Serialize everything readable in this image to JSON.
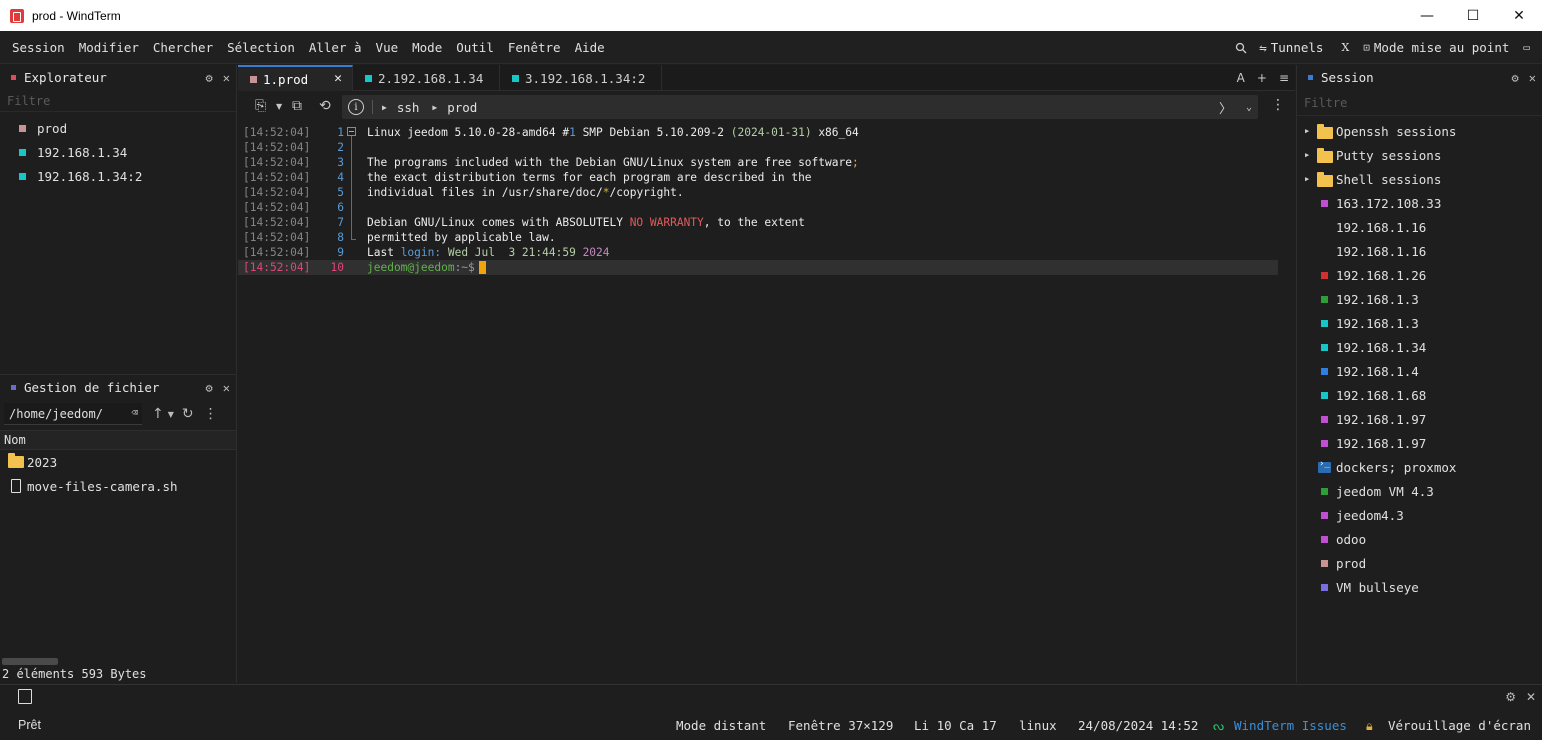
{
  "window": {
    "title": "prod - WindTerm",
    "controls": {
      "minimize": "—",
      "maximize": "☐",
      "close": "✕"
    }
  },
  "menu": {
    "items": [
      "Session",
      "Modifier",
      "Chercher",
      "Sélection",
      "Aller à",
      "Vue",
      "Mode",
      "Outil",
      "Fenêtre",
      "Aide"
    ],
    "right": {
      "tunnels": "Tunnels",
      "x_label": "X",
      "mode": "Mode mise au point"
    }
  },
  "explorer": {
    "title": "Explorateur",
    "filter_placeholder": "Filtre",
    "items": [
      {
        "label": "prod",
        "color": "#c89393"
      },
      {
        "label": "192.168.1.34",
        "color": "#17c7c7"
      },
      {
        "label": "192.168.1.34:2",
        "color": "#17c7c7"
      }
    ]
  },
  "file_manager": {
    "title": "Gestion de fichier",
    "path": "/home/jeedom/",
    "column_name": "Nom",
    "files": [
      {
        "name": "2023",
        "type": "folder"
      },
      {
        "name": "move-files-camera.sh",
        "type": "file"
      }
    ],
    "status": "2 éléments 593 Bytes"
  },
  "tabs": [
    {
      "label": "1.prod",
      "color": "#c89393",
      "active": true
    },
    {
      "label": "2.192.168.1.34",
      "color": "#17c7c7",
      "active": false
    },
    {
      "label": "3.192.168.1.34:2",
      "color": "#17c7c7",
      "active": false
    }
  ],
  "tab_actions": {
    "font": "A",
    "add": "+",
    "menu": "≡"
  },
  "address": {
    "segments": [
      "ssh",
      "prod"
    ]
  },
  "terminal": {
    "lines": [
      {
        "ts": "[14:52:04]",
        "n": "1",
        "segs": [
          [
            "Linux jeedom 5.10.0-28-amd64 #",
            "#ececec"
          ],
          [
            "1",
            "#5b9bd5"
          ],
          [
            " SMP Debian 5.10.209-2 ",
            "#ececec"
          ],
          [
            "(2024-01-31)",
            "#b5cea8"
          ],
          [
            " x86_64",
            "#ececec"
          ]
        ]
      },
      {
        "ts": "[14:52:04]",
        "n": "2",
        "segs": []
      },
      {
        "ts": "[14:52:04]",
        "n": "3",
        "segs": [
          [
            "The programs included with the Debian GNU/Linux system are free software",
            "#ececec"
          ],
          [
            ";",
            "#d4b44a"
          ]
        ]
      },
      {
        "ts": "[14:52:04]",
        "n": "4",
        "segs": [
          [
            "the exact distribution terms for each program are described in the",
            "#ececec"
          ]
        ]
      },
      {
        "ts": "[14:52:04]",
        "n": "5",
        "segs": [
          [
            "individual files in /usr/share/doc/",
            "#ececec"
          ],
          [
            "*",
            "#d4b44a"
          ],
          [
            "/copyright.",
            "#ececec"
          ]
        ]
      },
      {
        "ts": "[14:52:04]",
        "n": "6",
        "segs": []
      },
      {
        "ts": "[14:52:04]",
        "n": "7",
        "segs": [
          [
            "Debian GNU/Linux comes with ABSOLUTELY ",
            "#ececec"
          ],
          [
            "NO WARRANTY",
            "#e05a5a"
          ],
          [
            ", to the extent",
            "#ececec"
          ]
        ]
      },
      {
        "ts": "[14:52:04]",
        "n": "8",
        "segs": [
          [
            "permitted by applicable law.",
            "#ececec"
          ]
        ]
      },
      {
        "ts": "[14:52:04]",
        "n": "9",
        "segs": [
          [
            "Last ",
            "#ececec"
          ],
          [
            "login:",
            "#5b9bd5"
          ],
          [
            " Wed Jul  3 21:44:59 ",
            "#b5cea8"
          ],
          [
            "2024",
            "#c586c0"
          ]
        ]
      },
      {
        "ts": "[14:52:04]",
        "n": "10",
        "segs": [
          [
            "jeedom@jeedom",
            "#5fb34b"
          ],
          [
            ":~$",
            "#9a9a9a"
          ]
        ],
        "current": true
      }
    ],
    "colors": {
      "ts": "#858585",
      "ts_current": "#e0457a",
      "ln": "#5b9bd5",
      "ln_current": "#e0457a"
    }
  },
  "session": {
    "title": "Session",
    "filter_placeholder": "Filtre",
    "groups": [
      "Openssh sessions",
      "Putty sessions",
      "Shell sessions"
    ],
    "items": [
      {
        "label": "163.172.108.33",
        "color": "#c050d0"
      },
      {
        "label": "192.168.1.16",
        "color": ""
      },
      {
        "label": "192.168.1.16",
        "color": ""
      },
      {
        "label": "192.168.1.26",
        "color": "#d03030"
      },
      {
        "label": "192.168.1.3",
        "color": "#2e9e3a"
      },
      {
        "label": "192.168.1.3",
        "color": "#17c7c7"
      },
      {
        "label": "192.168.1.34",
        "color": "#17c7c7"
      },
      {
        "label": "192.168.1.4",
        "color": "#2f7fe0"
      },
      {
        "label": "192.168.1.68",
        "color": "#17c7c7"
      },
      {
        "label": "192.168.1.97",
        "color": "#c050d0"
      },
      {
        "label": "192.168.1.97",
        "color": "#c050d0"
      },
      {
        "label": "dockers; proxmox",
        "color": "powershell"
      },
      {
        "label": "jeedom VM 4.3",
        "color": "#2e9e3a"
      },
      {
        "label": "jeedom4.3",
        "color": "#c050d0"
      },
      {
        "label": "odoo",
        "color": "#c050d0"
      },
      {
        "label": "prod",
        "color": "#c89393"
      },
      {
        "label": "VM bullseye",
        "color": "#7b6fe0"
      }
    ]
  },
  "status": {
    "ready": "Prêt",
    "mode": "Mode distant",
    "window": "Fenêtre 37×129",
    "position": "Li 10 Ca 17",
    "os": "linux",
    "datetime": "24/08/2024 14:52",
    "issues": "WindTerm Issues",
    "lock": "Vérouillage d'écran"
  },
  "icons": {
    "settings": "gear-icon",
    "close": "close-icon",
    "search": "search-icon",
    "tunnel": "tunnel-icon",
    "focus": "focus-icon",
    "layout": "layout-icon"
  },
  "accent": "#3a7bd5"
}
